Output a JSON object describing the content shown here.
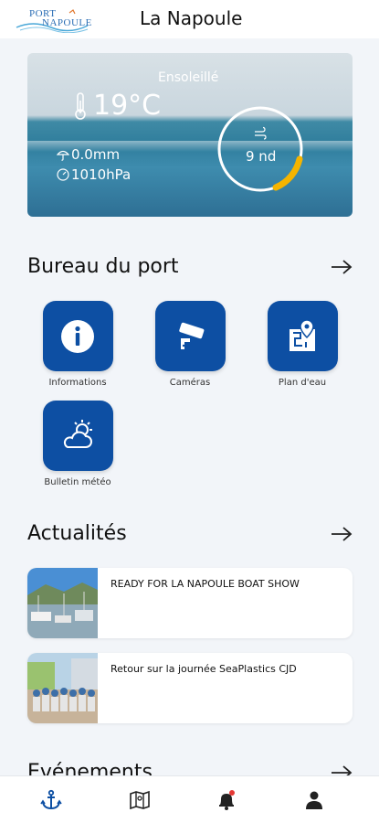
{
  "header": {
    "logo_text_top": "PORT",
    "logo_text_bottom": "NAPOULE",
    "title": "La Napoule"
  },
  "weather": {
    "condition": "Ensoleillé",
    "temperature": "19°C",
    "rain": "0.0mm",
    "pressure": "1010hPa",
    "wind_speed": "9 nd"
  },
  "bureau": {
    "title": "Bureau du port",
    "tiles": [
      {
        "label": "Informations",
        "icon": "info-icon"
      },
      {
        "label": "Caméras",
        "icon": "camera-icon"
      },
      {
        "label": "Plan d'eau",
        "icon": "map-icon"
      },
      {
        "label": "Bulletin météo",
        "icon": "weather-icon"
      }
    ]
  },
  "news": {
    "title": "Actualités",
    "items": [
      {
        "title": "READY FOR LA NAPOULE BOAT SHOW"
      },
      {
        "title": "Retour sur la journée SeaPlastics CJD"
      }
    ]
  },
  "events": {
    "title": "Evénements"
  },
  "nav": {
    "items": [
      "anchor-icon",
      "map-icon",
      "bell-icon",
      "user-icon"
    ],
    "active_color": "#0d4fa3",
    "badge_color": "#e53935"
  },
  "colors": {
    "brand": "#0d4fa3",
    "accent": "#f5b400"
  }
}
